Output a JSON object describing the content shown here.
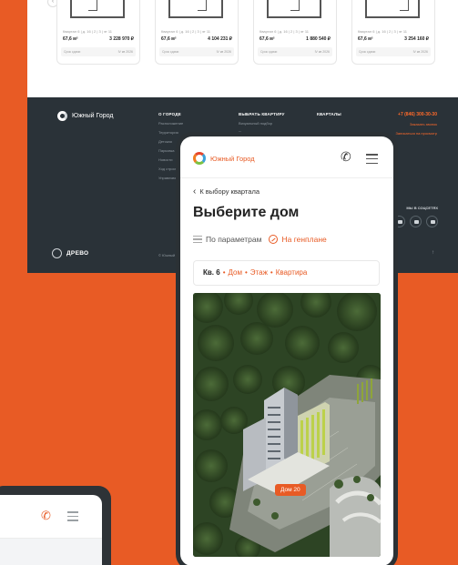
{
  "cards": [
    {
      "sub": "Квартал 6 | д. 16 | 2 | 3 | эт 11",
      "area": "67,6 м²",
      "price": "3 228 970 ₽",
      "meta_l": "Срок сдачи",
      "meta_r": "IV кв 2026"
    },
    {
      "sub": "Квартал 6 | д. 16 | 2 | 3 | эт 11",
      "area": "67,6 м²",
      "price": "4 104 231 ₽",
      "meta_l": "Срок сдачи",
      "meta_r": "IV кв 2026"
    },
    {
      "sub": "Квартал 6 | д. 16 | 2 | 3 | эт 11",
      "area": "67,6 м²",
      "price": "1 880 540 ₽",
      "meta_l": "Срок сдачи",
      "meta_r": "IV кв 2026"
    },
    {
      "sub": "Квартал 6 | д. 16 | 2 | 3 | эт 11",
      "area": "67,6 м²",
      "price": "3 254 160 ₽",
      "meta_l": "Срок сдачи",
      "meta_r": "IV кв 2026"
    }
  ],
  "footer": {
    "brand": "Южный Город",
    "col1": {
      "heading": "О ГОРОДЕ",
      "items": [
        "Расположение",
        "Территория",
        "Детская",
        "Парковка",
        "Новости",
        "Ход строительства",
        "Управляющая"
      ]
    },
    "col2": {
      "heading": "ВЫБРАТЬ КВАРТИРУ",
      "items": [
        "Визуальный подбор",
        "По параметрам"
      ]
    },
    "col3": {
      "heading": "КВАРТАЛЫ",
      "items": []
    },
    "phone": "+7 (846) 300-30-30",
    "links": [
      "Заказать звонок",
      "Записаться на просмотр"
    ],
    "social_label": "МЫ В СОЦСЕТЯХ",
    "partner": "ДРЕВО",
    "legal": "© Южный Город"
  },
  "app": {
    "brand": "Южный Город",
    "back_label": "К выбору квартала",
    "title": "Выберите дом",
    "mode_params": "По параметрам",
    "mode_plan": "На генплане",
    "crumb_quarter": "Кв. 6",
    "crumb_house": "Дом",
    "crumb_floor": "Этаж",
    "crumb_flat": "Квартира",
    "house_tag": "Дом 20"
  },
  "colors": {
    "accent": "#e85b25",
    "dark": "#2a3238",
    "forest": "#2f4626"
  }
}
